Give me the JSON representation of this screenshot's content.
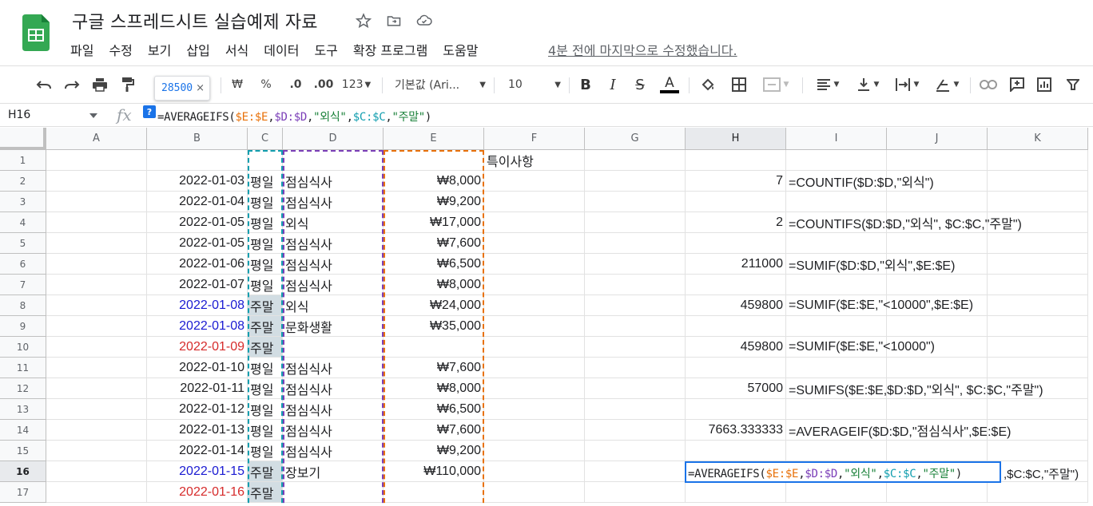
{
  "app": {
    "title": "구글 스프레드시트 실습예제 자료",
    "last_edit": "4분 전에 마지막으로 수정했습니다."
  },
  "menu": [
    "파일",
    "수정",
    "보기",
    "삽입",
    "서식",
    "데이터",
    "도구",
    "확장 프로그램",
    "도움말"
  ],
  "toolbar": {
    "tooltip_value": "28500",
    "currency": "₩",
    "percent": "%",
    "dec_decrease": ".0",
    "dec_increase": ".00",
    "number_format": "123",
    "font": "기본값 (Ari...",
    "font_size": "10"
  },
  "formula_bar": {
    "cell_ref": "H16",
    "fx": "fx",
    "help": "?",
    "parts": [
      "=AVERAGEIFS(",
      "$E:$E",
      ",",
      "$D:$D",
      ",",
      "\"외식\"",
      ",",
      "$C:$C",
      ",",
      "\"주말\"",
      ")"
    ]
  },
  "columns": [
    "A",
    "B",
    "C",
    "D",
    "E",
    "F",
    "G",
    "H",
    "I",
    "J",
    "K"
  ],
  "selected_column": "H",
  "selected_row": 16,
  "rows": [
    {
      "n": "1",
      "B": "",
      "C": "",
      "D": "",
      "E": "",
      "F": "특이사항",
      "H": "",
      "I": ""
    },
    {
      "n": "2",
      "B": "2022-01-03",
      "C": "평일",
      "D": "점심식사",
      "E": "₩8,000",
      "F": "",
      "H": "7",
      "I": "=COUNTIF($D:$D,\"외식\")"
    },
    {
      "n": "3",
      "B": "2022-01-04",
      "C": "평일",
      "D": "점심식사",
      "E": "₩9,200",
      "F": "",
      "H": "",
      "I": ""
    },
    {
      "n": "4",
      "B": "2022-01-05",
      "C": "평일",
      "D": "외식",
      "E": "₩17,000",
      "F": "",
      "H": "2",
      "I": "=COUNTIFS($D:$D,\"외식\", $C:$C,\"주말\")"
    },
    {
      "n": "5",
      "B": "2022-01-05",
      "C": "평일",
      "D": "점심식사",
      "E": "₩7,600",
      "F": "",
      "H": "",
      "I": ""
    },
    {
      "n": "6",
      "B": "2022-01-06",
      "C": "평일",
      "D": "점심식사",
      "E": "₩6,500",
      "F": "",
      "H": "211000",
      "I": "=SUMIF($D:$D,\"외식\",$E:$E)"
    },
    {
      "n": "7",
      "B": "2022-01-07",
      "C": "평일",
      "D": "점심식사",
      "E": "₩8,000",
      "F": "",
      "H": "",
      "I": ""
    },
    {
      "n": "8",
      "B": "2022-01-08",
      "C": "주말",
      "D": "외식",
      "E": "₩24,000",
      "F": "",
      "H": "459800",
      "I": "=SUMIF($E:$E,\"<10000\",$E:$E)"
    },
    {
      "n": "9",
      "B": "2022-01-08",
      "C": "주말",
      "D": "문화생활",
      "E": "₩35,000",
      "F": "",
      "H": "",
      "I": ""
    },
    {
      "n": "10",
      "B": "2022-01-09",
      "C": "주말",
      "D": "",
      "E": "",
      "F": "",
      "H": "459800",
      "I": "=SUMIF($E:$E,\"<10000\")"
    },
    {
      "n": "11",
      "B": "2022-01-10",
      "C": "평일",
      "D": "점심식사",
      "E": "₩7,600",
      "F": "",
      "H": "",
      "I": ""
    },
    {
      "n": "12",
      "B": "2022-01-11",
      "C": "평일",
      "D": "점심식사",
      "E": "₩8,000",
      "F": "",
      "H": "57000",
      "I": "=SUMIFS($E:$E,$D:$D,\"외식\", $C:$C,\"주말\")"
    },
    {
      "n": "13",
      "B": "2022-01-12",
      "C": "평일",
      "D": "점심식사",
      "E": "₩6,500",
      "F": "",
      "H": "",
      "I": ""
    },
    {
      "n": "14",
      "B": "2022-01-13",
      "C": "평일",
      "D": "점심식사",
      "E": "₩7,600",
      "F": "",
      "H": "7663.333333",
      "I": "=AVERAGEIF($D:$D,\"점심식사\",$E:$E)"
    },
    {
      "n": "15",
      "B": "2022-01-14",
      "C": "평일",
      "D": "점심식사",
      "E": "₩9,200",
      "F": "",
      "H": "",
      "I": ""
    },
    {
      "n": "16",
      "B": "2022-01-15",
      "C": "주말",
      "D": "장보기",
      "E": "₩110,000",
      "F": "",
      "H": "",
      "I": ""
    },
    {
      "n": "17",
      "B": "2022-01-16",
      "C": "주말",
      "D": "",
      "E": "",
      "F": "",
      "H": "",
      "I": ""
    }
  ],
  "editor": {
    "parts": [
      "=AVERAGEIFS(",
      "$E:$E",
      ",",
      "$D:$D",
      ",",
      "\"외식\"",
      ",",
      "$C:$C",
      ",",
      "\"주말\"",
      ")"
    ],
    "spill": ",$C:$C,\"주말\")"
  },
  "colors": {
    "saturday": "#1a1ad2",
    "sunday": "#d62b2b",
    "weekend_fill": "#d2dde3",
    "accent": "#1a73e8"
  }
}
